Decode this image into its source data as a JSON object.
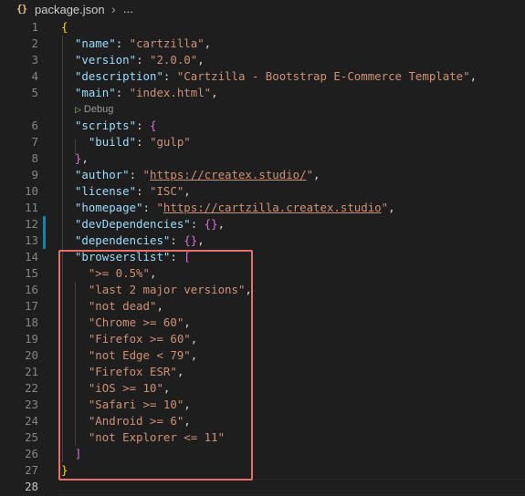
{
  "breadcrumb": {
    "icon": "{}",
    "file": "package.json",
    "separator": "›",
    "more": "..."
  },
  "codelens": {
    "label": "Debug"
  },
  "lines": [
    {
      "n": "1",
      "tokens": [
        [
          "brace",
          "{"
        ]
      ]
    },
    {
      "n": "2",
      "tokens": [
        [
          "p",
          "  "
        ],
        [
          "key",
          "\"name\""
        ],
        [
          "p",
          ": "
        ],
        [
          "str",
          "\"cartzilla\""
        ],
        [
          "p",
          ","
        ]
      ]
    },
    {
      "n": "3",
      "tokens": [
        [
          "p",
          "  "
        ],
        [
          "key",
          "\"version\""
        ],
        [
          "p",
          ": "
        ],
        [
          "str",
          "\"2.0.0\""
        ],
        [
          "p",
          ","
        ]
      ]
    },
    {
      "n": "4",
      "tokens": [
        [
          "p",
          "  "
        ],
        [
          "key",
          "\"description\""
        ],
        [
          "p",
          ": "
        ],
        [
          "str",
          "\"Cartzilla - Bootstrap E-Commerce Template\""
        ],
        [
          "p",
          ","
        ]
      ]
    },
    {
      "n": "5",
      "tokens": [
        [
          "p",
          "  "
        ],
        [
          "key",
          "\"main\""
        ],
        [
          "p",
          ": "
        ],
        [
          "str",
          "\"index.html\""
        ],
        [
          "p",
          ","
        ]
      ]
    },
    {
      "n": "6",
      "tokens": [
        [
          "p",
          "  "
        ],
        [
          "key",
          "\"scripts\""
        ],
        [
          "p",
          ": "
        ],
        [
          "brace2",
          "{"
        ]
      ]
    },
    {
      "n": "7",
      "tokens": [
        [
          "p",
          "    "
        ],
        [
          "key",
          "\"build\""
        ],
        [
          "p",
          ": "
        ],
        [
          "str",
          "\"gulp\""
        ]
      ]
    },
    {
      "n": "8",
      "tokens": [
        [
          "p",
          "  "
        ],
        [
          "brace2",
          "}"
        ],
        [
          "p",
          ","
        ]
      ]
    },
    {
      "n": "9",
      "tokens": [
        [
          "p",
          "  "
        ],
        [
          "key",
          "\"author\""
        ],
        [
          "p",
          ": "
        ],
        [
          "str",
          "\""
        ],
        [
          "url",
          "https://createx.studio/"
        ],
        [
          "str",
          "\""
        ],
        [
          "p",
          ","
        ]
      ]
    },
    {
      "n": "10",
      "tokens": [
        [
          "p",
          "  "
        ],
        [
          "key",
          "\"license\""
        ],
        [
          "p",
          ": "
        ],
        [
          "str",
          "\"ISC\""
        ],
        [
          "p",
          ","
        ]
      ]
    },
    {
      "n": "11",
      "tokens": [
        [
          "p",
          "  "
        ],
        [
          "key",
          "\"homepage\""
        ],
        [
          "p",
          ": "
        ],
        [
          "str",
          "\""
        ],
        [
          "url",
          "https://cartzilla.createx.studio"
        ],
        [
          "str",
          "\""
        ],
        [
          "p",
          ","
        ]
      ]
    },
    {
      "n": "12",
      "tokens": [
        [
          "p",
          "  "
        ],
        [
          "key",
          "\"devDependencies\""
        ],
        [
          "p",
          ": "
        ],
        [
          "brace2",
          "{}"
        ],
        [
          "p",
          ","
        ]
      ]
    },
    {
      "n": "13",
      "tokens": [
        [
          "p",
          "  "
        ],
        [
          "key",
          "\"dependencies\""
        ],
        [
          "p",
          ": "
        ],
        [
          "brace2",
          "{}"
        ],
        [
          "p",
          ","
        ]
      ]
    },
    {
      "n": "14",
      "tokens": [
        [
          "p",
          "  "
        ],
        [
          "key",
          "\"browserslist\""
        ],
        [
          "p",
          ": "
        ],
        [
          "brace2",
          "["
        ]
      ]
    },
    {
      "n": "15",
      "tokens": [
        [
          "p",
          "    "
        ],
        [
          "str",
          "\">= 0.5%\""
        ],
        [
          "p",
          ","
        ]
      ]
    },
    {
      "n": "16",
      "tokens": [
        [
          "p",
          "    "
        ],
        [
          "str",
          "\"last 2 major versions\""
        ],
        [
          "p",
          ","
        ]
      ]
    },
    {
      "n": "17",
      "tokens": [
        [
          "p",
          "    "
        ],
        [
          "str",
          "\"not dead\""
        ],
        [
          "p",
          ","
        ]
      ]
    },
    {
      "n": "18",
      "tokens": [
        [
          "p",
          "    "
        ],
        [
          "str",
          "\"Chrome >= 60\""
        ],
        [
          "p",
          ","
        ]
      ]
    },
    {
      "n": "19",
      "tokens": [
        [
          "p",
          "    "
        ],
        [
          "str",
          "\"Firefox >= 60\""
        ],
        [
          "p",
          ","
        ]
      ]
    },
    {
      "n": "20",
      "tokens": [
        [
          "p",
          "    "
        ],
        [
          "str",
          "\"not Edge < 79\""
        ],
        [
          "p",
          ","
        ]
      ]
    },
    {
      "n": "21",
      "tokens": [
        [
          "p",
          "    "
        ],
        [
          "str",
          "\"Firefox ESR\""
        ],
        [
          "p",
          ","
        ]
      ]
    },
    {
      "n": "22",
      "tokens": [
        [
          "p",
          "    "
        ],
        [
          "str",
          "\"iOS >= 10\""
        ],
        [
          "p",
          ","
        ]
      ]
    },
    {
      "n": "23",
      "tokens": [
        [
          "p",
          "    "
        ],
        [
          "str",
          "\"Safari >= 10\""
        ],
        [
          "p",
          ","
        ]
      ]
    },
    {
      "n": "24",
      "tokens": [
        [
          "p",
          "    "
        ],
        [
          "str",
          "\"Android >= 6\""
        ],
        [
          "p",
          ","
        ]
      ]
    },
    {
      "n": "25",
      "tokens": [
        [
          "p",
          "    "
        ],
        [
          "str",
          "\"not Explorer <= 11\""
        ]
      ]
    },
    {
      "n": "26",
      "tokens": [
        [
          "p",
          "  "
        ],
        [
          "brace2",
          "]"
        ]
      ]
    },
    {
      "n": "27",
      "tokens": [
        [
          "brace",
          "}"
        ]
      ]
    },
    {
      "n": "28",
      "tokens": []
    }
  ],
  "modified_lines": [
    "12",
    "13"
  ],
  "active_line": "28",
  "colors": {
    "key": "#9cdcfe",
    "string": "#ce9178",
    "bracket_level1": "#ffd700",
    "bracket_level2": "#da70d6",
    "highlight_box": "#e8706a"
  }
}
